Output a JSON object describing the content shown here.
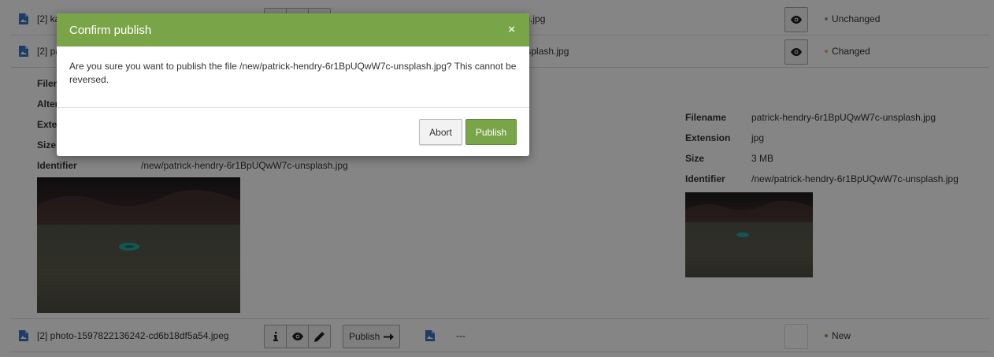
{
  "colors": {
    "accent": "#79a548",
    "changed": "#f0ad4e",
    "unchanged": "#999999",
    "new": "#79a548",
    "file_icon": "#3a73c2"
  },
  "rows": [
    {
      "name": "[2] ka",
      "target": "9zImG4-unsplash.jpg",
      "status": "Unchanged"
    },
    {
      "name": "[2] pa",
      "target": "1BpUQwW7c-unsplash.jpg",
      "status": "Changed"
    },
    {
      "name": "[2] photo-1597822136242-cd6b18df5a54.jpeg",
      "target": "---",
      "status": "New",
      "publish_label": "Publish"
    }
  ],
  "detail_left": {
    "labels": {
      "filename": "Filen",
      "alternative": "Alter",
      "extension": "Exte",
      "size": "Size",
      "identifier": "Identifier"
    },
    "identifier_value": "/new/patrick-hendry-6r1BpUQwW7c-unsplash.jpg"
  },
  "detail_right": {
    "filename_label": "Filename",
    "filename_value": "patrick-hendry-6r1BpUQwW7c-unsplash.jpg",
    "extension_label": "Extension",
    "extension_value": "jpg",
    "size_label": "Size",
    "size_value": "3 MB",
    "identifier_label": "Identifier",
    "identifier_value": "/new/patrick-hendry-6r1BpUQwW7c-unsplash.jpg"
  },
  "modal": {
    "title": "Confirm publish",
    "close_glyph": "×",
    "message": "Are you sure you want to publish the file /new/patrick-hendry-6r1BpUQwW7c-unsplash.jpg? This cannot be reversed.",
    "abort_label": "Abort",
    "publish_label": "Publish"
  }
}
